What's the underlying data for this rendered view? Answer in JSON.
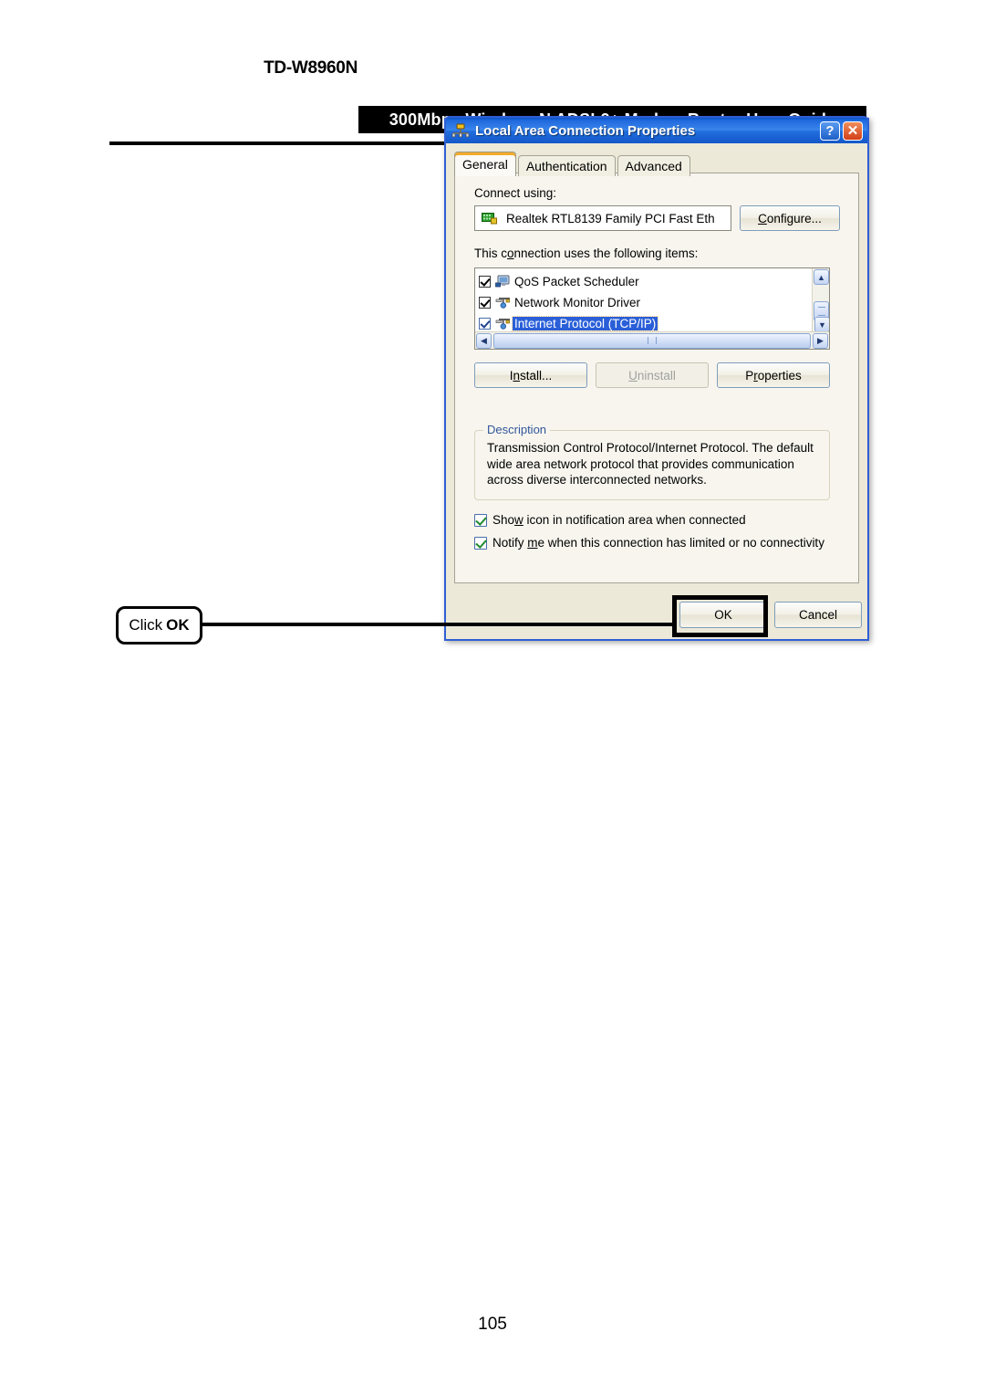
{
  "header": {
    "model": "TD-W8960N",
    "banner": "300Mbps  Wireless  N  ADSL2+  Modem  Router  User  Guide"
  },
  "annotation": {
    "click_label": "Click",
    "target_label": "OK"
  },
  "dialog": {
    "title": "Local Area Connection Properties",
    "title_icon": "network-connection-icon",
    "help_button": "?",
    "close_button": "✕",
    "tabs": [
      {
        "label": "General",
        "active": true
      },
      {
        "label": "Authentication",
        "active": false
      },
      {
        "label": "Advanced",
        "active": false
      }
    ],
    "connect_using_label": "Connect using:",
    "adapter": {
      "icon": "network-adapter-icon",
      "name": "Realtek RTL8139 Family PCI Fast Eth"
    },
    "configure_button": "Configure...",
    "items_label_pre": "This c",
    "items_label_accel": "o",
    "items_label_post": "nnection uses the following items:",
    "items": [
      {
        "label": "QoS Packet Scheduler",
        "checked": true,
        "selected": false,
        "icon": "qos-monitor-icon"
      },
      {
        "label": "Network Monitor Driver",
        "checked": true,
        "selected": false,
        "icon": "network-protocol-icon"
      },
      {
        "label": "Internet Protocol (TCP/IP)",
        "checked": true,
        "selected": true,
        "icon": "network-protocol-icon"
      }
    ],
    "buttons": {
      "install": "Install...",
      "install_pre": "I",
      "install_accel": "n",
      "install_post": "stall...",
      "uninstall": "Uninstall",
      "uninstall_accel": "U",
      "uninstall_post": "ninstall",
      "properties": "Properties",
      "properties_pre": "P",
      "properties_accel": "r",
      "properties_post": "operties",
      "uninstall_disabled": true
    },
    "description": {
      "legend": "Description",
      "text": "Transmission Control Protocol/Internet Protocol. The default wide area network protocol that provides communication across diverse interconnected networks."
    },
    "options": [
      {
        "pre": "Sho",
        "accel": "w",
        "post": " icon in notification area when connected",
        "checked": true
      },
      {
        "pre": "Notify ",
        "accel": "m",
        "post": "e when this connection has limited or no connectivity",
        "checked": true
      }
    ],
    "footer": {
      "ok": "OK",
      "cancel": "Cancel"
    }
  },
  "page_number": "105",
  "colors": {
    "titlebar_blue": "#2f5fd4",
    "dialog_face": "#ece9d8",
    "tabpage_face": "#f7f5ee",
    "selection_blue": "#2a5fd8",
    "active_tab_accent": "#f2ab29",
    "legend_blue": "#31569b",
    "close_red": "#d23f18"
  }
}
